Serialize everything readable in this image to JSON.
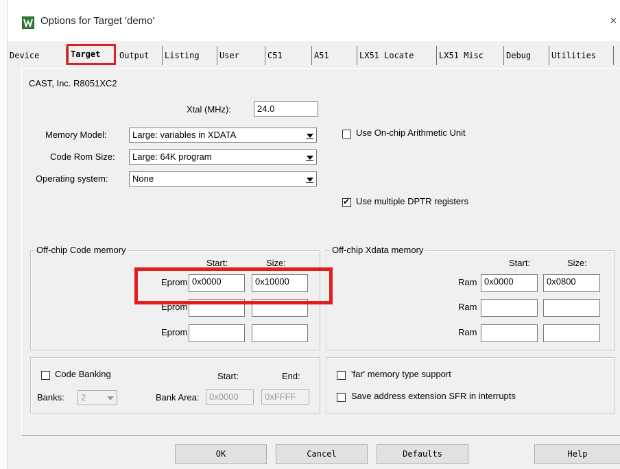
{
  "window": {
    "title": "Options for Target 'demo'",
    "close_glyph": "×"
  },
  "tabs": [
    {
      "label": "Device"
    },
    {
      "label": "Target"
    },
    {
      "label": "Output"
    },
    {
      "label": "Listing"
    },
    {
      "label": "User"
    },
    {
      "label": "C51"
    },
    {
      "label": "A51"
    },
    {
      "label": "LX51 Locate"
    },
    {
      "label": "LX51 Misc"
    },
    {
      "label": "Debug"
    },
    {
      "label": "Utilities"
    }
  ],
  "target": {
    "device_name": "CAST, Inc. R8051XC2",
    "xtal_label": "Xtal (MHz):",
    "xtal_value": "24.0",
    "memory_model_label": "Memory Model:",
    "memory_model_value": "Large: variables in XDATA",
    "code_rom_label": "Code Rom Size:",
    "code_rom_value": "Large: 64K program",
    "os_label": "Operating system:",
    "os_value": "None",
    "arith_label": "Use On-chip Arithmetic Unit",
    "dptr_label": "Use multiple DPTR registers"
  },
  "code_memory": {
    "title": "Off-chip Code memory",
    "start_header": "Start:",
    "size_header": "Size:",
    "rows": [
      {
        "label": "Eprom",
        "start": "0x0000",
        "size": "0x10000"
      },
      {
        "label": "Eprom",
        "start": "",
        "size": ""
      },
      {
        "label": "Eprom",
        "start": "",
        "size": ""
      }
    ]
  },
  "xdata_memory": {
    "title": "Off-chip Xdata memory",
    "start_header": "Start:",
    "size_header": "Size:",
    "rows": [
      {
        "label": "Ram",
        "start": "0x0000",
        "size": "0x0800"
      },
      {
        "label": "Ram",
        "start": "",
        "size": ""
      },
      {
        "label": "Ram",
        "start": "",
        "size": ""
      }
    ]
  },
  "banking": {
    "code_banking_label": "Code Banking",
    "start_header": "Start:",
    "end_header": "End:",
    "banks_label": "Banks:",
    "banks_value": "2",
    "bank_area_label": "Bank Area:",
    "bank_area_start": "0x0000",
    "bank_area_end": "0xFFFF"
  },
  "far_options": {
    "far_label": "'far' memory type support",
    "save_sfr_label": "Save address extension SFR in interrupts"
  },
  "buttons": {
    "ok": "OK",
    "cancel": "Cancel",
    "defaults": "Defaults",
    "help": "Help"
  },
  "colors": {
    "highlight": "#e21d1d",
    "dialog_bg": "#f0f0f0",
    "icon_green": "#2e7d32"
  }
}
